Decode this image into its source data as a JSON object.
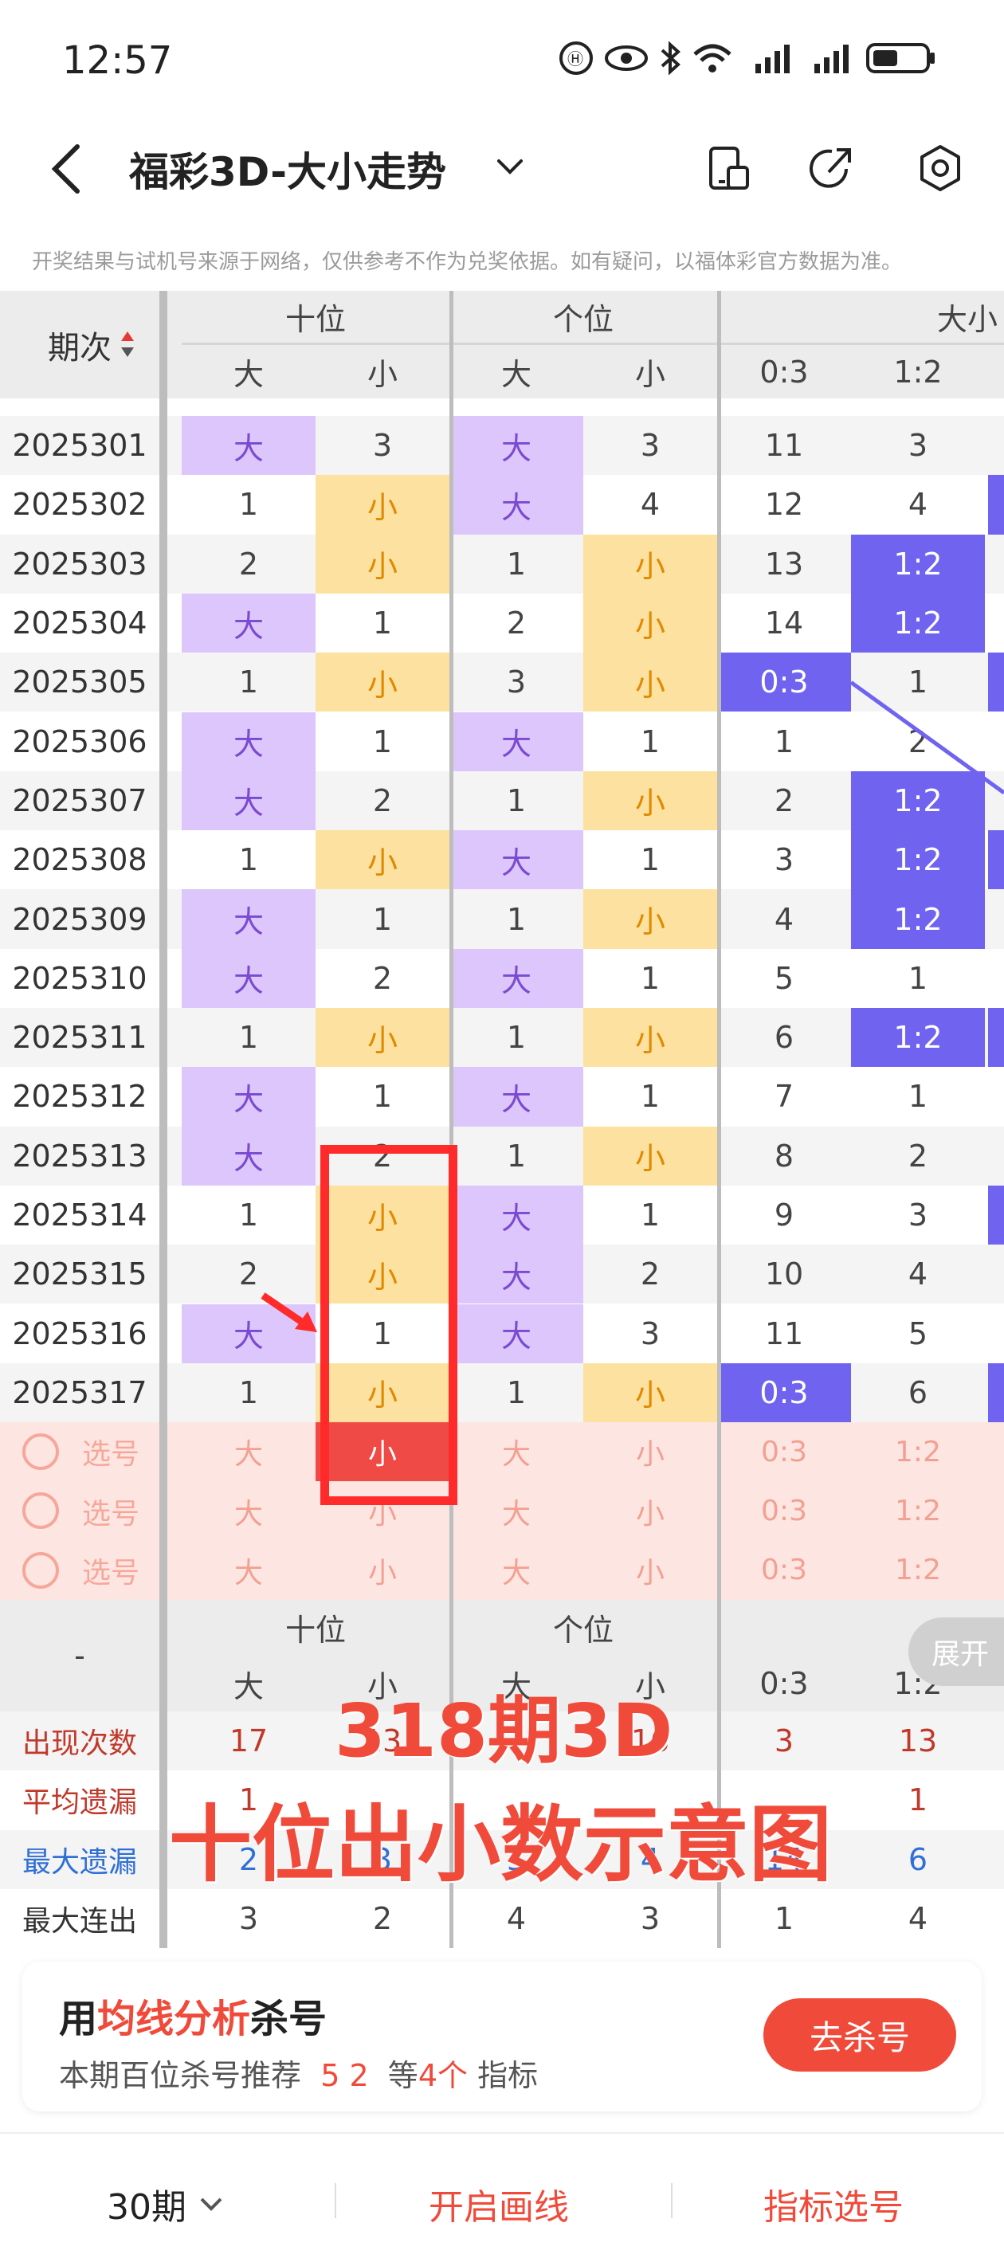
{
  "status_bar": {
    "time": "12:57",
    "icons": [
      "hd-voice-icon",
      "eye-icon",
      "bluetooth-icon",
      "wifi-icon",
      "signal-icon",
      "signal-icon",
      "battery-icon"
    ]
  },
  "header": {
    "title": "福彩3D-大小走势",
    "icons": [
      "back-icon",
      "chevron-down-icon",
      "phone-icon",
      "share-icon",
      "settings-icon"
    ]
  },
  "notice": "开奖结果与试机号来源于网络，仅供参考不作为兑奖依据。如有疑问，以福体彩官方数据为准。",
  "table": {
    "period_header": "期次",
    "groups": [
      "十位",
      "个位",
      "大小"
    ],
    "subheaders": [
      "大",
      "小",
      "大",
      "小",
      "0:3",
      "1:2"
    ],
    "rows": [
      {
        "period": "2025301",
        "cells": [
          "大",
          "3",
          "大",
          "3",
          "11",
          "3"
        ]
      },
      {
        "period": "2025302",
        "cells": [
          "1",
          "小",
          "大",
          "4",
          "12",
          "4"
        ]
      },
      {
        "period": "2025303",
        "cells": [
          "2",
          "小",
          "1",
          "小",
          "13",
          "1:2"
        ]
      },
      {
        "period": "2025304",
        "cells": [
          "大",
          "1",
          "2",
          "小",
          "14",
          "1:2"
        ]
      },
      {
        "period": "2025305",
        "cells": [
          "1",
          "小",
          "3",
          "小",
          "0:3",
          "1"
        ]
      },
      {
        "period": "2025306",
        "cells": [
          "大",
          "1",
          "大",
          "1",
          "1",
          "2"
        ]
      },
      {
        "period": "2025307",
        "cells": [
          "大",
          "2",
          "1",
          "小",
          "2",
          "1:2"
        ]
      },
      {
        "period": "2025308",
        "cells": [
          "1",
          "小",
          "大",
          "1",
          "3",
          "1:2"
        ]
      },
      {
        "period": "2025309",
        "cells": [
          "大",
          "1",
          "1",
          "小",
          "4",
          "1:2"
        ]
      },
      {
        "period": "2025310",
        "cells": [
          "大",
          "2",
          "大",
          "1",
          "5",
          "1"
        ]
      },
      {
        "period": "2025311",
        "cells": [
          "1",
          "小",
          "1",
          "小",
          "6",
          "1:2"
        ]
      },
      {
        "period": "2025312",
        "cells": [
          "大",
          "1",
          "大",
          "1",
          "7",
          "1"
        ]
      },
      {
        "period": "2025313",
        "cells": [
          "大",
          "2",
          "1",
          "小",
          "8",
          "2"
        ]
      },
      {
        "period": "2025314",
        "cells": [
          "1",
          "小",
          "大",
          "1",
          "9",
          "3"
        ]
      },
      {
        "period": "2025315",
        "cells": [
          "2",
          "小",
          "大",
          "2",
          "10",
          "4"
        ]
      },
      {
        "period": "2025316",
        "cells": [
          "大",
          "1",
          "大",
          "3",
          "11",
          "5"
        ]
      },
      {
        "period": "2025317",
        "cells": [
          "1",
          "小",
          "1",
          "小",
          "0:3",
          "6"
        ]
      }
    ],
    "select_rows": [
      {
        "label": "选号",
        "cells": [
          "大",
          "小",
          "大",
          "小",
          "0:3",
          "1:2"
        ]
      },
      {
        "label": "选号",
        "cells": [
          "大",
          "小",
          "大",
          "小",
          "0:3",
          "1:2"
        ]
      },
      {
        "label": "选号",
        "cells": [
          "大",
          "小",
          "大",
          "小",
          "0:3",
          "1:2"
        ]
      }
    ],
    "footer_dash": "-",
    "footer_groups": [
      "十位",
      "个位"
    ],
    "footer_subheaders": [
      "大",
      "小",
      "大",
      "小",
      "0:3",
      "1:2"
    ],
    "expand_label": "展开",
    "stats": [
      {
        "label": "出现次数",
        "cells": [
          "17",
          "13",
          "",
          "16",
          "3",
          "13"
        ]
      },
      {
        "label": "平均遗漏",
        "cells": [
          "1",
          "",
          "",
          "",
          "",
          "1"
        ]
      },
      {
        "label": "最大遗漏",
        "cells": [
          "2",
          "3",
          "3",
          "4",
          "14",
          "6"
        ]
      },
      {
        "label": "最大连出",
        "cells": [
          "3",
          "2",
          "4",
          "3",
          "1",
          "4"
        ]
      }
    ]
  },
  "overlay": {
    "line1": "318期3D",
    "line2": "十位出小数示意图"
  },
  "promo": {
    "title_pre": "用",
    "title_hl": "均线分析",
    "title_post": "杀号",
    "sub_pre": "本期百位杀号推荐",
    "sub_nums": "5 2",
    "sub_mid": "等",
    "sub_count": "4个",
    "sub_post": "指标",
    "button": "去杀号"
  },
  "bottom_bar": {
    "periods": "30期",
    "draw_line": "开启画线",
    "indicator": "指标选号"
  },
  "colors": {
    "purple": "#dcc6fb",
    "yellow": "#fde1a0",
    "blue": "#6f63f0",
    "red": "#f04a3a",
    "pink": "#fde6e2"
  }
}
